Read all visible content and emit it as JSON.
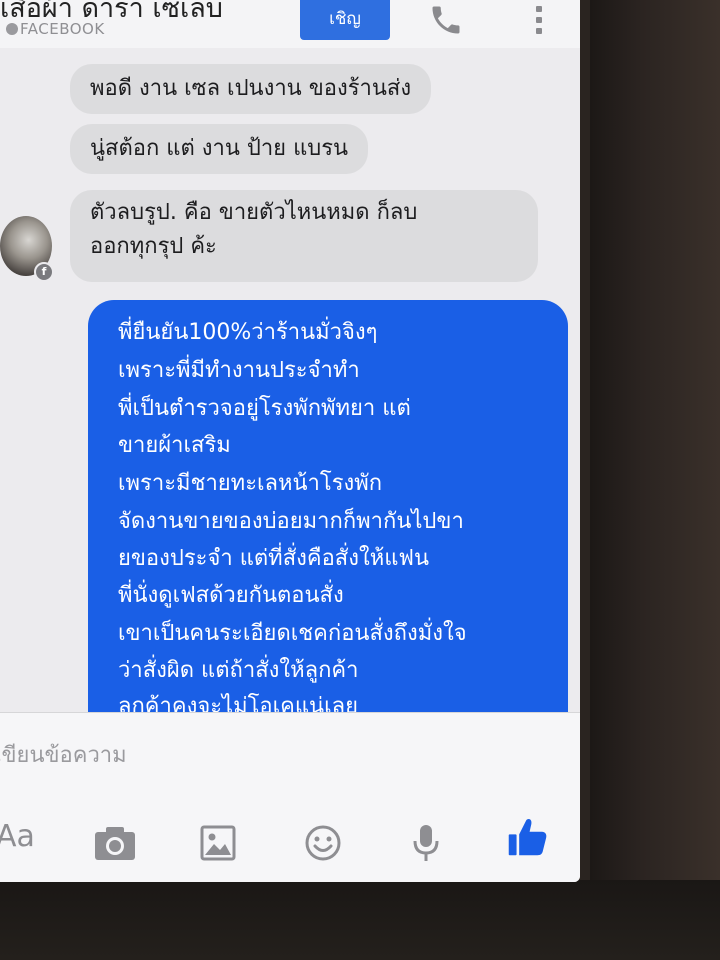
{
  "header": {
    "title": "เสื้อผ้า ดารา เซเลบ",
    "subtitle": "FACEBOOK",
    "invite_label": "เชิญ"
  },
  "messages": {
    "received": [
      "พอดี งาน เซล เปนงาน ของร้านส่ง",
      "นู่สต้อก แต่ งาน ป้าย แบรน",
      "ตัวลบรูป. คือ ขายตัวไหนหมด ก็ลบ",
      "ออกทุกรุป ค้ะ"
    ],
    "sent": [
      "พี่ยืนยัน100%ว่าร้านมั่วจิงๆ",
      "เพราะพี่มีทำงานประจำทำ",
      "พี่เป็นตำรวจอยู่โรงพักพัทยา แต่",
      "ขายผ้าเสริม",
      "เพราะมีชายทะเลหน้าโรงพัก",
      "จัดงานขายของบ่อยมากก็พากันไปขา",
      "ยของประจำ แต่ที่สั่งคือสั่งให้แฟน",
      "พี่นั่งดูเฟสด้วยกันตอนสั่ง",
      "เขาเป็นคนระเอียดเชคก่อนสั่งถึงมั่งใจ",
      "ว่าสั่งผิด แต่ถ้าสั่งให้ลูกค้า",
      "ลูกค้าคงจะไม่โอเคแน่เลย"
    ]
  },
  "composer": {
    "placeholder": "เขียนข้อความ",
    "aa_label": "Aa"
  },
  "icons": {
    "camera": "camera-icon",
    "image": "image-icon",
    "emoji": "emoji-icon",
    "mic": "microphone-icon",
    "like": "thumbs-up-icon",
    "call": "phone-icon",
    "more": "more-vertical-icon"
  },
  "colors": {
    "accent": "#1a5fe6",
    "received_bubble": "#dcdcde",
    "header_button": "#2f6fe0"
  }
}
